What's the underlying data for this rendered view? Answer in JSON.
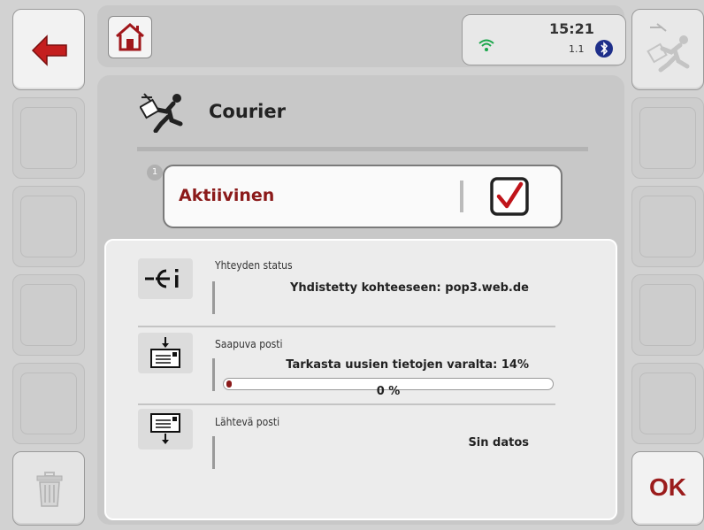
{
  "status": {
    "time": "15:21",
    "version": "1.1"
  },
  "header": {
    "title": "Courier"
  },
  "toggle": {
    "badge": "1",
    "label": "Aktiivinen",
    "checked": true
  },
  "rows": [
    {
      "icon": "connection-info-icon",
      "label": "Yhteyden status",
      "value": "Yhdistetty kohteeseen: pop3.web.de"
    },
    {
      "icon": "incoming-mail-icon",
      "label": "Saapuva posti",
      "value": "Tarkasta uusien tietojen varalta: 14%",
      "progress_text": "0 %",
      "progress": 0.01
    },
    {
      "icon": "outgoing-mail-icon",
      "label": "Lähtevä posti",
      "value": "Sin datos"
    }
  ],
  "buttons": {
    "ok": "OK"
  },
  "colors": {
    "accent": "#8b1a1a",
    "checkbox_check": "#c0141a"
  }
}
